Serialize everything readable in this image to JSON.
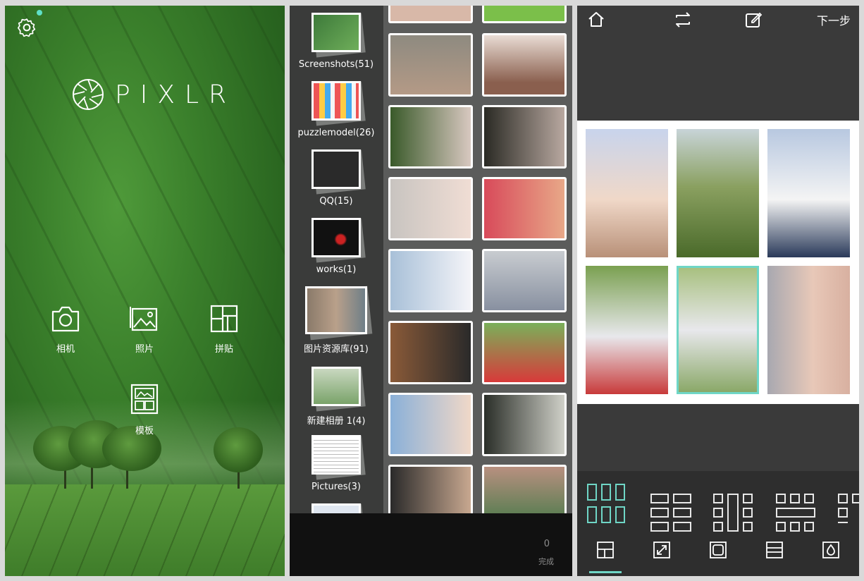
{
  "home": {
    "logo_text": "PIXLR",
    "buttons": [
      {
        "label": "相机",
        "icon": "camera-icon"
      },
      {
        "label": "照片",
        "icon": "photo-icon"
      },
      {
        "label": "拼贴",
        "icon": "collage-icon"
      },
      {
        "label": "模板",
        "icon": "template-icon"
      }
    ],
    "settings_icon": "gear-icon",
    "accent": "#5fe0c8"
  },
  "gallery": {
    "albums": [
      {
        "label": "Screenshots(51)",
        "thumb": "#3d7a3a"
      },
      {
        "label": "puzzlemodel(26)",
        "thumb": "#e8d9c8"
      },
      {
        "label": "QQ(15)",
        "thumb": "#2a2a2a"
      },
      {
        "label": "works(1)",
        "thumb": "#111111"
      },
      {
        "label": "图片资源库(91)",
        "thumb": "#7a8a90"
      },
      {
        "label": "新建相册 1(4)",
        "thumb": "#9bb78e"
      },
      {
        "label": "Pictures(3)",
        "thumb": "#f4f4f4"
      }
    ],
    "selected_count": "0",
    "done_label": "完成"
  },
  "collage": {
    "next_label": "下一步",
    "accent": "#6fd6c6",
    "icons": [
      "home-icon",
      "swap-icon",
      "edit-icon"
    ],
    "tool_icons": [
      "layout-icon",
      "resize-icon",
      "border-icon",
      "ratio-icon",
      "background-icon"
    ]
  }
}
